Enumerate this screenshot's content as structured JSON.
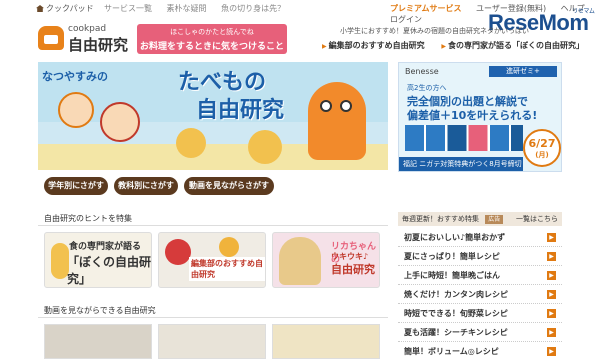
{
  "topbar": {
    "home_label": "クックパッド",
    "links": [
      "サービス一覧",
      "素朴な疑問",
      "魚の切り身は先？"
    ],
    "premium": "プレミアムサービス",
    "register": "ユーザー登録(無料)",
    "help": "ヘルプ",
    "login": "ログイン"
  },
  "logo": {
    "brand": "cookpad",
    "title": "自由研究"
  },
  "pink_banner": {
    "small": "ほこしゃのかたと読んでね",
    "main": "お料理をするときに気をつけること"
  },
  "tagline": "小学生におすすめ！夏休みの宿題の自由研究ネタがいっぱい",
  "sublinks": [
    "編集部のおすすめ自由研究",
    "食の専門家が語る「ぼくの自由研究」"
  ],
  "watermark": {
    "name": "ReseMom",
    "sub": "リセマム"
  },
  "hero": {
    "natsu": "なつやすみの",
    "title1": "たべもの",
    "title2": "自由研究"
  },
  "buttons": [
    "学年別にさがす",
    "教科別にさがす",
    "動画を見ながらさがす"
  ],
  "section1": "自由研究のヒントを特集",
  "thumbs": {
    "t1_a": "食の専門家が語る",
    "t1_b": "「ぼくの自由研究」",
    "t2_a": "編集部のおすすめ自由研究",
    "t3_a": "リカちゃんの",
    "t3_b": "ウキウキ♪",
    "t3_c": "自由研究"
  },
  "section2": "動画を見ながらできる自由研究",
  "ad": {
    "brand": "Benesse",
    "badge": "進研ゼミ+",
    "line1": "高2生の方へ",
    "line2": "完全個別の出題と解説で",
    "line3": "偏差値＋10を叶えられる!",
    "date": "6/27",
    "date_day": "(月)",
    "footer": "福記 ニガテ対策特典がつく8月号締切は"
  },
  "recipes": {
    "header": "毎週更新！おすすめ特集",
    "tag": "広告",
    "more": "一覧はこちら",
    "items": [
      "初夏においしい♪簡単おかず",
      "夏にさっぱり！簡単レシピ",
      "上手に時短！簡単晩ごはん",
      "焼くだけ！カンタン肉レシピ",
      "時短でできる！旬野菜レシピ",
      "夏も活躍！シーチキンレシピ",
      "簡単！ボリューム◎レシピ"
    ]
  }
}
